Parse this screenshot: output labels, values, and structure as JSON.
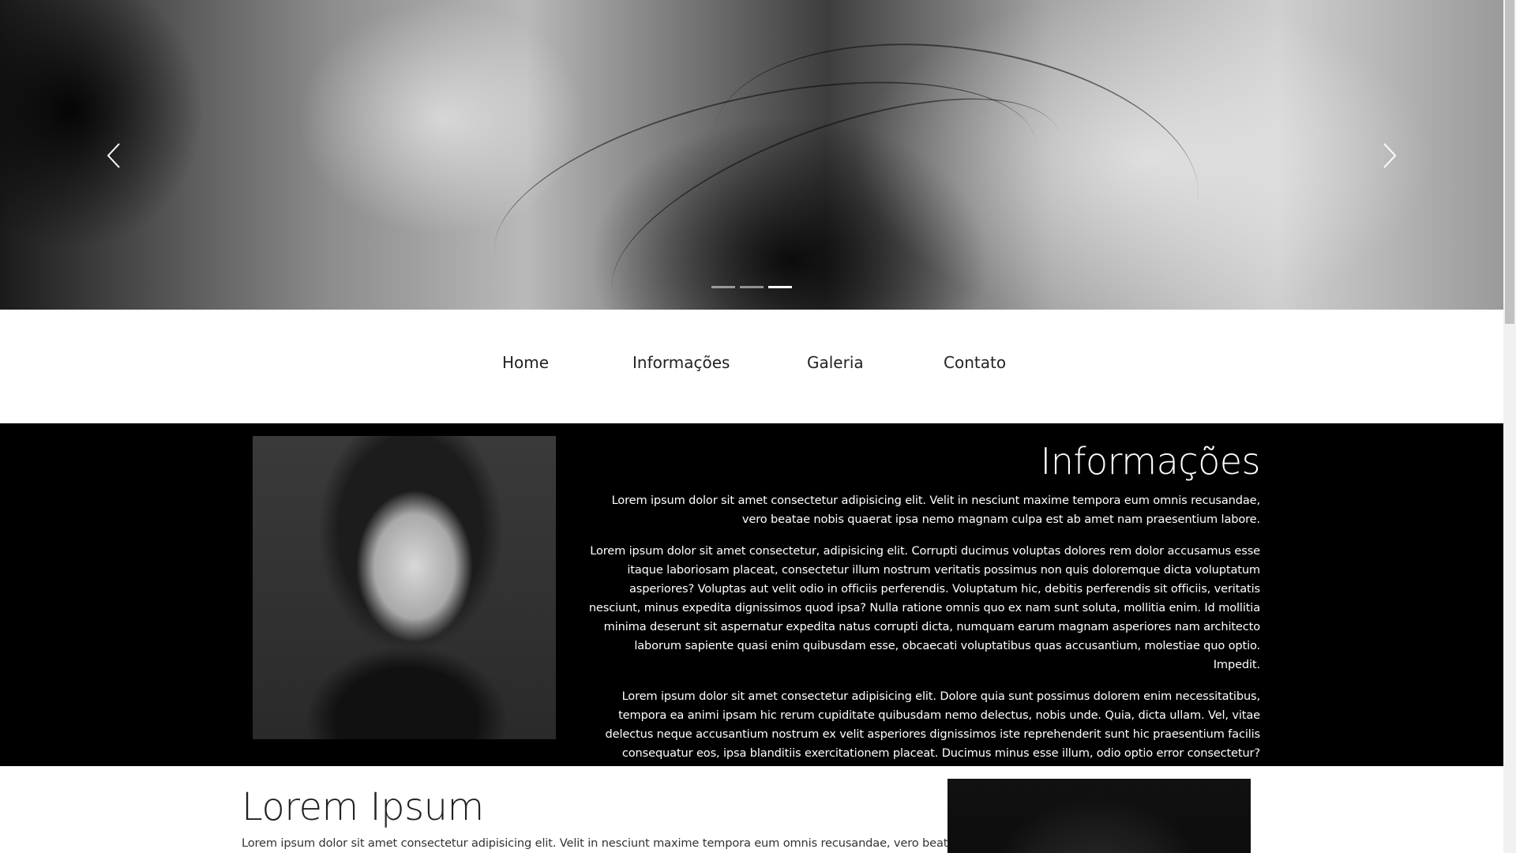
{
  "carousel": {
    "slides_count": 3,
    "active_index": 2,
    "prev_icon": "chevron-left-icon",
    "next_icon": "chevron-right-icon"
  },
  "nav": {
    "items": [
      {
        "label": "Home"
      },
      {
        "label": "Informações"
      },
      {
        "label": "Galeria"
      },
      {
        "label": "Contato"
      }
    ]
  },
  "info": {
    "title": "Informações",
    "paragraphs": [
      "Lorem ipsum dolor sit amet consectetur adipisicing elit. Velit in nesciunt maxime tempora eum omnis recusandae, vero beatae nobis quaerat ipsa nemo magnam culpa est ab amet nam praesentium labore.",
      "Lorem ipsum dolor sit amet consectetur, adipisicing elit. Corrupti ducimus voluptas dolores rem dolor accusamus esse itaque laboriosam placeat, consectetur illum nostrum veritatis possimus non quis doloremque dicta voluptatum asperiores? Voluptas aut velit odio in officiis perferendis. Voluptatum hic, debitis perferendis sit officiis, veritatis nesciunt, minus expedita dignissimos quod ipsa? Nulla ratione omnis quo ex nam sunt soluta, mollitia enim. Id mollitia minima deserunt sit aspernatur expedita natus corrupti dicta, numquam earum magnam asperiores nam architecto laborum sapiente quasi enim quibusdam esse, obcaecati voluptatibus quas accusantium, molestiae quo optio. Impedit.",
      "Lorem ipsum dolor sit amet consectetur adipisicing elit. Dolore quia sunt possimus dolorem enim necessitatibus, tempora ea animi ipsam hic rerum cupiditate quibusdam nemo delectus, nobis unde. Quia, dicta ullam. Vel, vitae delectus neque accusantium nostrum ex velit asperiores dignissimos iste reprehenderit sunt hic praesentium facilis consequatur eos, ipsa blanditiis exercitationem placeat. Ducimus minus esse illum, odio optio error consectetur?"
    ]
  },
  "lorem": {
    "title": "Lorem Ipsum",
    "paragraph": "Lorem ipsum dolor sit amet consectetur adipisicing elit. Velit in nesciunt maxime tempora eum omnis recusandae, vero beatae"
  },
  "colors": {
    "info_bg": "#000000",
    "page_bg": "#ffffff",
    "nav_text": "#222222"
  }
}
